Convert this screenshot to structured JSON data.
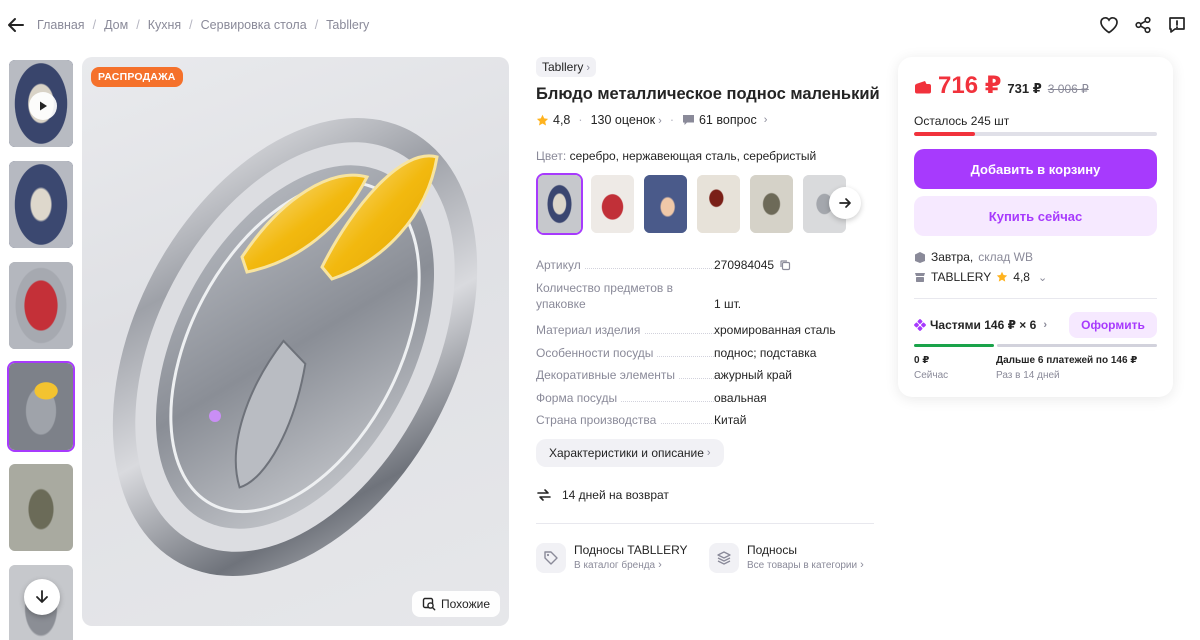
{
  "breadcrumbs": [
    "Главная",
    "Дом",
    "Кухня",
    "Сервировка стола",
    "Tabllery"
  ],
  "main_image": {
    "sale_badge": "РАСПРОДАЖА",
    "similar_label": "Похожие"
  },
  "product": {
    "brand": "Tabllery",
    "title": "Блюдо металлическое поднос маленький",
    "rating": "4,8",
    "reviews": "130 оценок",
    "questions": "61 вопрос",
    "color_label": "Цвет:",
    "color_value": "серебро, нержавеющая сталь, серебристый"
  },
  "specs": [
    {
      "key": "Артикул",
      "value": "270984045"
    },
    {
      "key": "Количество предметов в упаковке",
      "value": "1 шт."
    },
    {
      "key": "Материал изделия",
      "value": "хромированная сталь"
    },
    {
      "key": "Особенности посуды",
      "value": "поднос; подставка"
    },
    {
      "key": "Декоративные элементы",
      "value": "ажурный край"
    },
    {
      "key": "Форма посуды",
      "value": "овальная"
    },
    {
      "key": "Страна производства",
      "value": "Китай"
    }
  ],
  "characteristics_button": "Характеристики и описание",
  "return_text": "14 дней на возврат",
  "links": {
    "brand_catalog": {
      "title": "Подносы TABLLERY",
      "sub": "В каталог бренда"
    },
    "category": {
      "title": "Подносы",
      "sub": "Все товары в категории"
    }
  },
  "buy_panel": {
    "price": "716 ₽",
    "card_price": "731 ₽",
    "old_price": "3 006 ₽",
    "stock_text": "Осталось 245 шт",
    "stock_fraction": 0.25,
    "add_to_cart": "Добавить в корзину",
    "buy_now": "Купить сейчас",
    "delivery_day": "Завтра,",
    "delivery_warehouse": "склад WB",
    "seller": "TABLLERY",
    "seller_rating": "4,8",
    "installments": "Частями 146 ₽ × 6",
    "installments_button": "Оформить",
    "pay_now_amount": "0 ₽",
    "pay_now_label": "Сейчас",
    "pay_later_amount": "Дальше 6 платежей по 146 ₽",
    "pay_later_label": "Раз в 14 дней"
  },
  "colors": {
    "accent": "#a73afd",
    "price": "#f1323c",
    "sale_badge": "#f5712b",
    "installment_green": "#1aa34a"
  }
}
